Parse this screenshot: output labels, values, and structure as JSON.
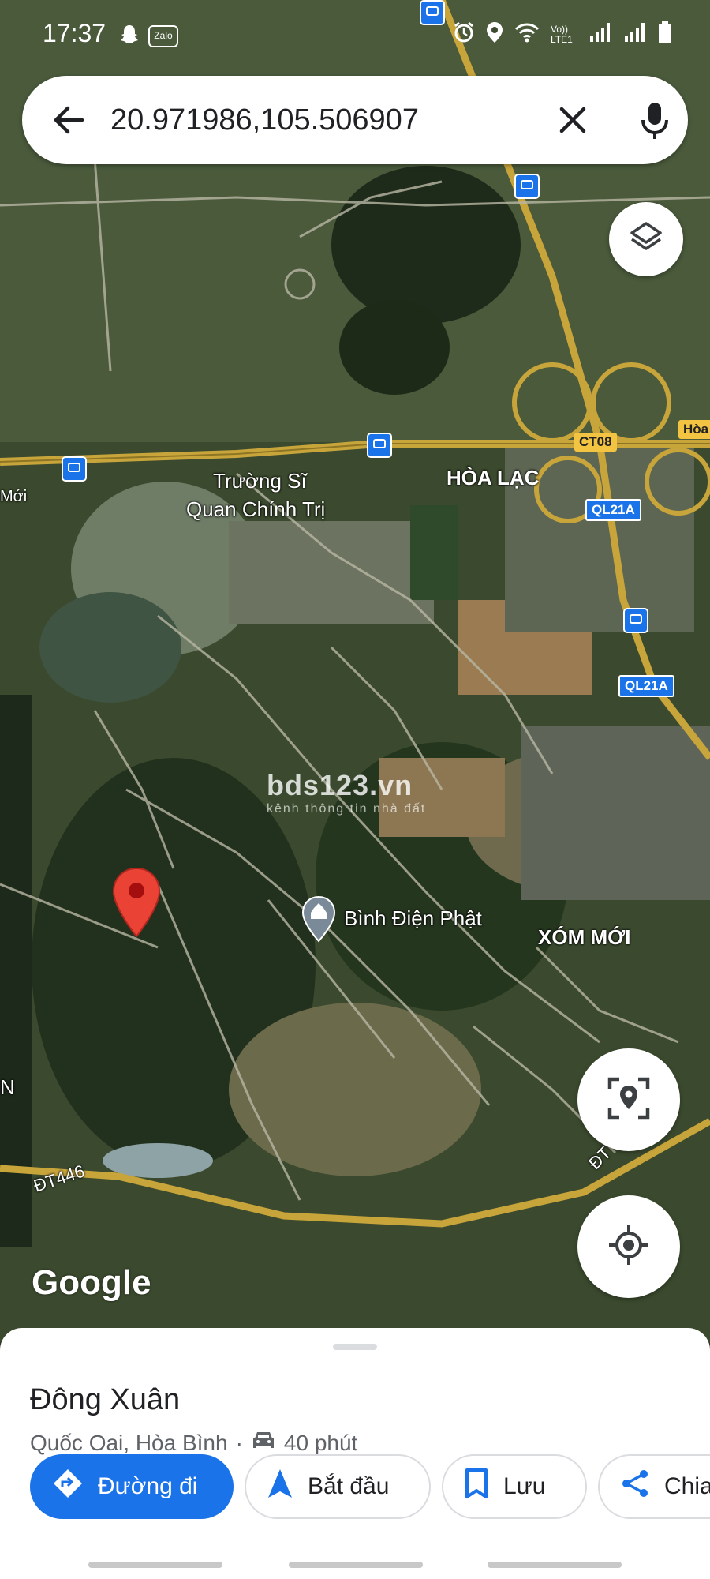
{
  "status_bar": {
    "time": "17:37",
    "icons": [
      "snapchat-icon",
      "zalo-icon",
      "alarm-icon",
      "location-icon",
      "wifi-icon",
      "volte-icon",
      "signal-icon",
      "battery-icon"
    ],
    "volte_label": "Vo)) LTE1",
    "zalo_label": "Zalo"
  },
  "search": {
    "query": "20.971986,105.506907"
  },
  "map": {
    "labels": {
      "truong_si_quan_1": "Trường Sĩ",
      "truong_si_quan_2": "Quan Chính Trị",
      "hoa_lac": "HÒA LẠC",
      "binh_dien_phat": "Bình Điện Phật",
      "xom_moi": "XÓM MỚI",
      "dt446": "ĐT446",
      "dt_right": "ĐT",
      "moi_edge": "Mới",
      "n_edge": "N",
      "hoa_edge": "Hòa"
    },
    "shields": {
      "ct08": "CT08",
      "ql21a_1": "QL21A",
      "ql21a_2": "QL21A"
    },
    "watermark": {
      "title": "bds123.vn",
      "subtitle": "kênh thông tin nhà đất"
    },
    "google_logo": "Google",
    "colors": {
      "pin": "#ea4335",
      "road": "#c8a53b",
      "accent": "#1a73e8"
    }
  },
  "sheet": {
    "title": "Đông Xuân",
    "location": "Quốc Oai, Hòa Bình",
    "separator": "·",
    "drive_time": "40 phút",
    "actions": {
      "directions": "Đường đi",
      "start": "Bắt đầu",
      "save": "Lưu",
      "share": "Chia"
    }
  }
}
